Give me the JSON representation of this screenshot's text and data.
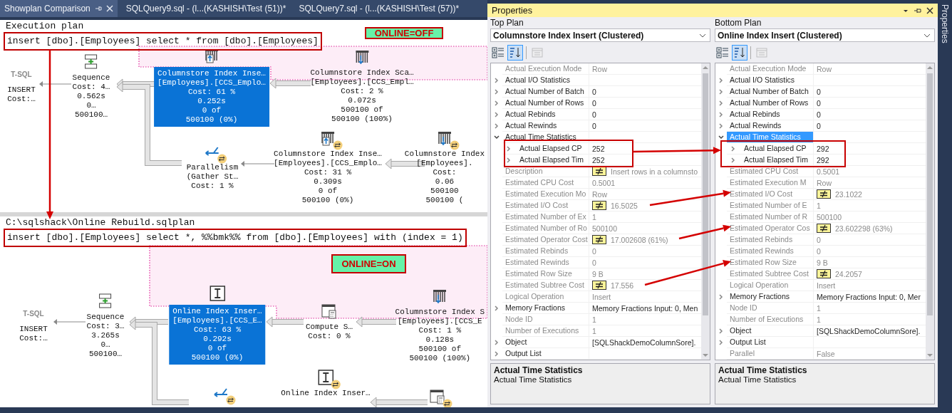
{
  "tabs": [
    {
      "label": "Showplan Comparison",
      "selected": true
    },
    {
      "label": "SQLQuery9.sql - (l...(KASHISH\\Test (51))*",
      "selected": false
    },
    {
      "label": "SQLQuery7.sql - (l...(KASHISH\\Test (57))*",
      "selected": false
    }
  ],
  "top_plan": {
    "title": "Execution plan",
    "query": "insert [dbo].[Employees] select * from [dbo].[Employees]",
    "note": "ONLINE=OFF",
    "nodes": [
      {
        "kind": "statement",
        "type_label": "T-SQL",
        "lines": [
          "INSERT",
          "Cost:…"
        ],
        "selected": false,
        "parallel": false
      },
      {
        "kind": "sequence",
        "lines": [
          "Sequence",
          "Cost: 4…",
          "0.562s",
          "0…",
          "500100…"
        ],
        "selected": false,
        "parallel": false
      },
      {
        "kind": "columnstore_insert",
        "lines": [
          "Columnstore Index Inse…",
          "[Employees].[CCS_Emplo…",
          "Cost: 61 %",
          "0.252s",
          "0 of",
          "500100 (0%)"
        ],
        "selected": true,
        "parallel": false
      },
      {
        "kind": "columnstore_scan",
        "lines": [
          "Columnstore Index Sca…",
          "[Employees].[CCS_Empl…",
          "Cost: 2 %",
          "0.072s",
          "500100 of",
          "500100 (100%)"
        ],
        "selected": false,
        "parallel": false
      },
      {
        "kind": "parallelism",
        "lines": [
          "Parallelism",
          "(Gather St…",
          "Cost: 1 %"
        ],
        "selected": false,
        "parallel": true
      },
      {
        "kind": "columnstore_insert",
        "lines": [
          "Columnstore Index Inse…",
          "[Employees].[CCS_Emplo…",
          "Cost: 31 %",
          "0.309s",
          "0 of",
          "500100 (0%)"
        ],
        "selected": false,
        "parallel": true
      },
      {
        "kind": "columnstore_scan",
        "lines": [
          "Columnstore Index",
          "[Employees].",
          "Cost:",
          "0.06",
          "500100",
          "500100 ("
        ],
        "selected": false,
        "parallel": true
      }
    ]
  },
  "bottom_plan": {
    "title": "C:\\sqlshack\\Online Rebuild.sqlplan",
    "query": "insert [dbo].[Employees] select *, %%bmk%% from [dbo].[Employees] with (index = 1)",
    "note": "ONLINE=ON",
    "nodes": [
      {
        "kind": "statement",
        "type_label": "T-SQL",
        "lines": [
          "INSERT",
          "Cost:…"
        ],
        "selected": false,
        "parallel": false
      },
      {
        "kind": "sequence",
        "lines": [
          "Sequence",
          "Cost: 3…",
          "3.265s",
          "0…",
          "500100…"
        ],
        "selected": false,
        "parallel": false
      },
      {
        "kind": "online_insert",
        "lines": [
          "Online Index Inser…",
          "[Employees].[CCS_E…",
          "Cost: 63 %",
          "0.292s",
          "0 of",
          "500100 (0%)"
        ],
        "selected": true,
        "parallel": false
      },
      {
        "kind": "compute_scalar",
        "lines": [
          "Compute S…",
          "Cost: 0 %"
        ],
        "selected": false,
        "parallel": false
      },
      {
        "kind": "columnstore_scan",
        "lines": [
          "Columnstore Index S",
          "[Employees].[CCS_E",
          "Cost: 1 %",
          "0.128s",
          "500100 of",
          "500100 (100%)"
        ],
        "selected": false,
        "parallel": false
      },
      {
        "kind": "parallelism",
        "selected": false,
        "parallel": true
      },
      {
        "kind": "online_insert",
        "lines": [
          "Online Index Inser…"
        ],
        "selected": false,
        "parallel": true
      },
      {
        "kind": "compute_scalar",
        "selected": false,
        "parallel": true
      }
    ]
  },
  "properties": {
    "title": "Properties",
    "plans": [
      {
        "label": "Top Plan",
        "operator": "Columnstore Index Insert (Clustered)",
        "toolbar": [
          {
            "kind": "categorized",
            "selected": false,
            "disabled": false
          },
          {
            "kind": "alphabetical",
            "selected": true,
            "disabled": false
          },
          {
            "kind": "pages",
            "selected": false,
            "disabled": true
          }
        ],
        "rows": [
          {
            "kind": "value",
            "name": "Actual Execution Mode",
            "value": "Row",
            "readonly": true,
            "differs": false,
            "selected": false
          },
          {
            "kind": "group",
            "name": "Actual I/O Statistics",
            "readonly": false,
            "expanded": false,
            "differs": false,
            "selected": false
          },
          {
            "kind": "group",
            "name": "Actual Number of Batch",
            "value": "0",
            "readonly": false,
            "expanded": false,
            "differs": false,
            "selected": false
          },
          {
            "kind": "group",
            "name": "Actual Number of Rows",
            "value": "0",
            "readonly": false,
            "expanded": false,
            "differs": false,
            "selected": false
          },
          {
            "kind": "group",
            "name": "Actual Rebinds",
            "value": "0",
            "readonly": false,
            "expanded": false,
            "differs": false,
            "selected": false
          },
          {
            "kind": "group",
            "name": "Actual Rewinds",
            "value": "0",
            "readonly": false,
            "expanded": false,
            "differs": false,
            "selected": false
          },
          {
            "kind": "group",
            "name": "Actual Time Statistics",
            "readonly": false,
            "expanded": true,
            "differs": false,
            "selected": false,
            "children": [
              {
                "kind": "group",
                "name": "Actual Elapsed CP",
                "value": "252",
                "readonly": false,
                "expanded": false,
                "differs": false,
                "selected": false
              },
              {
                "kind": "group",
                "name": "Actual Elapsed Tim",
                "value": "252",
                "readonly": false,
                "expanded": false,
                "differs": false,
                "selected": false
              }
            ]
          },
          {
            "kind": "value",
            "name": "Description",
            "value": "Insert rows in a columnsto",
            "readonly": true,
            "differs": true,
            "selected": false
          },
          {
            "kind": "value",
            "name": "Estimated CPU Cost",
            "value": "0.5001",
            "readonly": true,
            "differs": false,
            "selected": false
          },
          {
            "kind": "value",
            "name": "Estimated Execution Mo",
            "value": "Row",
            "readonly": true,
            "differs": false,
            "selected": false
          },
          {
            "kind": "value",
            "name": "Estimated I/O Cost",
            "value": "16.5025",
            "readonly": true,
            "differs": true,
            "selected": false
          },
          {
            "kind": "value",
            "name": "Estimated Number of Ex",
            "value": "1",
            "readonly": true,
            "differs": false,
            "selected": false
          },
          {
            "kind": "value",
            "name": "Estimated Number of Ro",
            "value": "500100",
            "readonly": true,
            "differs": false,
            "selected": false
          },
          {
            "kind": "value",
            "name": "Estimated Operator Cost",
            "value": "17.002608 (61%)",
            "readonly": true,
            "differs": true,
            "selected": false
          },
          {
            "kind": "value",
            "name": "Estimated Rebinds",
            "value": "0",
            "readonly": true,
            "differs": false,
            "selected": false
          },
          {
            "kind": "value",
            "name": "Estimated Rewinds",
            "value": "0",
            "readonly": true,
            "differs": false,
            "selected": false
          },
          {
            "kind": "value",
            "name": "Estimated Row Size",
            "value": "9 B",
            "readonly": true,
            "differs": false,
            "selected": false
          },
          {
            "kind": "value",
            "name": "Estimated Subtree Cost",
            "value": "17.556",
            "readonly": true,
            "differs": true,
            "selected": false
          },
          {
            "kind": "value",
            "name": "Logical Operation",
            "value": "Insert",
            "readonly": true,
            "differs": false,
            "selected": false
          },
          {
            "kind": "group",
            "name": "Memory Fractions",
            "value": "Memory Fractions Input: 0, Men",
            "readonly": false,
            "expanded": false,
            "differs": false,
            "selected": false
          },
          {
            "kind": "value",
            "name": "Node ID",
            "value": "1",
            "readonly": true,
            "differs": false,
            "selected": false
          },
          {
            "kind": "value",
            "name": "Number of Executions",
            "value": "1",
            "readonly": true,
            "differs": false,
            "selected": false
          },
          {
            "kind": "group",
            "name": "Object",
            "value": "[SQLShackDemoColumnSore].",
            "readonly": false,
            "expanded": false,
            "differs": false,
            "selected": false
          },
          {
            "kind": "group",
            "name": "Output List",
            "readonly": false,
            "expanded": false,
            "differs": false,
            "selected": false
          }
        ],
        "description": {
          "title": "Actual Time Statistics",
          "text": "Actual Time Statistics"
        }
      },
      {
        "label": "Bottom Plan",
        "operator": "Online Index Insert (Clustered)",
        "toolbar": [
          {
            "kind": "categorized",
            "selected": false,
            "disabled": false
          },
          {
            "kind": "alphabetical",
            "selected": true,
            "disabled": false
          },
          {
            "kind": "pages",
            "selected": false,
            "disabled": true
          }
        ],
        "rows": [
          {
            "kind": "value",
            "name": "Actual Execution Mode",
            "value": "Row",
            "readonly": true,
            "differs": false,
            "selected": false
          },
          {
            "kind": "group",
            "name": "Actual I/O Statistics",
            "readonly": false,
            "expanded": false,
            "differs": false,
            "selected": false
          },
          {
            "kind": "group",
            "name": "Actual Number of Batch",
            "value": "0",
            "readonly": false,
            "expanded": false,
            "differs": false,
            "selected": false
          },
          {
            "kind": "group",
            "name": "Actual Number of Rows",
            "value": "0",
            "readonly": false,
            "expanded": false,
            "differs": false,
            "selected": false
          },
          {
            "kind": "group",
            "name": "Actual Rebinds",
            "value": "0",
            "readonly": false,
            "expanded": false,
            "differs": false,
            "selected": false
          },
          {
            "kind": "group",
            "name": "Actual Rewinds",
            "value": "0",
            "readonly": false,
            "expanded": false,
            "differs": false,
            "selected": false
          },
          {
            "kind": "group",
            "name": "Actual Time Statistics",
            "readonly": false,
            "expanded": true,
            "differs": false,
            "selected": true,
            "children": [
              {
                "kind": "group",
                "name": "Actual Elapsed CP",
                "value": "292",
                "readonly": false,
                "expanded": false,
                "differs": false,
                "selected": false
              },
              {
                "kind": "group",
                "name": "Actual Elapsed Tim",
                "value": "292",
                "readonly": false,
                "expanded": false,
                "differs": false,
                "selected": false
              }
            ]
          },
          {
            "kind": "value",
            "name": "Estimated CPU Cost",
            "value": "0.5001",
            "readonly": true,
            "differs": false,
            "selected": false
          },
          {
            "kind": "value",
            "name": "Estimated Execution M",
            "value": "Row",
            "readonly": true,
            "differs": false,
            "selected": false
          },
          {
            "kind": "value",
            "name": "Estimated I/O Cost",
            "value": "23.1022",
            "readonly": true,
            "differs": true,
            "selected": false
          },
          {
            "kind": "value",
            "name": "Estimated Number of E",
            "value": "1",
            "readonly": true,
            "differs": false,
            "selected": false
          },
          {
            "kind": "value",
            "name": "Estimated Number of R",
            "value": "500100",
            "readonly": true,
            "differs": false,
            "selected": false
          },
          {
            "kind": "value",
            "name": "Estimated Operator Cos",
            "value": "23.602298 (63%)",
            "readonly": true,
            "differs": true,
            "selected": false
          },
          {
            "kind": "value",
            "name": "Estimated Rebinds",
            "value": "0",
            "readonly": true,
            "differs": false,
            "selected": false
          },
          {
            "kind": "value",
            "name": "Estimated Rewinds",
            "value": "0",
            "readonly": true,
            "differs": false,
            "selected": false
          },
          {
            "kind": "value",
            "name": "Estimated Row Size",
            "value": "9 B",
            "readonly": true,
            "differs": false,
            "selected": false
          },
          {
            "kind": "value",
            "name": "Estimated Subtree Cost",
            "value": "24.2057",
            "readonly": true,
            "differs": true,
            "selected": false
          },
          {
            "kind": "value",
            "name": "Logical Operation",
            "value": "Insert",
            "readonly": true,
            "differs": false,
            "selected": false
          },
          {
            "kind": "group",
            "name": "Memory Fractions",
            "value": "Memory Fractions Input: 0, Mer",
            "readonly": false,
            "expanded": false,
            "differs": false,
            "selected": false
          },
          {
            "kind": "value",
            "name": "Node ID",
            "value": "1",
            "readonly": true,
            "differs": false,
            "selected": false
          },
          {
            "kind": "value",
            "name": "Number of Executions",
            "value": "1",
            "readonly": true,
            "differs": false,
            "selected": false
          },
          {
            "kind": "group",
            "name": "Object",
            "value": "[SQLShackDemoColumnSore].",
            "readonly": false,
            "expanded": false,
            "differs": false,
            "selected": false
          },
          {
            "kind": "group",
            "name": "Output List",
            "readonly": false,
            "expanded": false,
            "differs": false,
            "selected": false
          },
          {
            "kind": "value",
            "name": "Parallel",
            "value": "False",
            "readonly": true,
            "differs": false,
            "selected": false
          }
        ],
        "description": {
          "title": "Actual Time Statistics",
          "text": "Actual Time Statistics"
        }
      }
    ]
  },
  "side_tab": "Properties"
}
